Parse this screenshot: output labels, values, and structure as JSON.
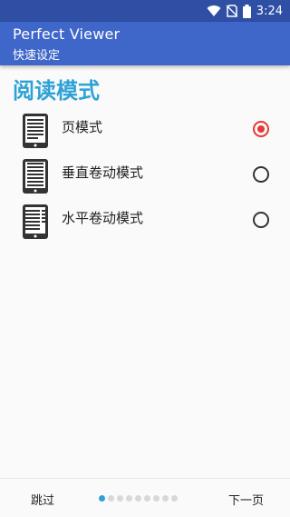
{
  "status_bar": {
    "time": "3:24"
  },
  "app_bar": {
    "title": "Perfect Viewer",
    "subtitle": "快速设定"
  },
  "section": {
    "title": "阅读模式"
  },
  "options": [
    {
      "label": "页模式",
      "selected": true
    },
    {
      "label": "垂直卷动模式",
      "selected": false
    },
    {
      "label": "水平卷动模式",
      "selected": false
    }
  ],
  "bottom": {
    "skip_label": "跳过",
    "next_label": "下一页",
    "page_count": 9,
    "current_page": 1
  },
  "colors": {
    "status_bar": "#2f4fa5",
    "app_bar": "#3f66c9",
    "accent": "#2ea2d6",
    "radio_selected": "#e53935"
  }
}
